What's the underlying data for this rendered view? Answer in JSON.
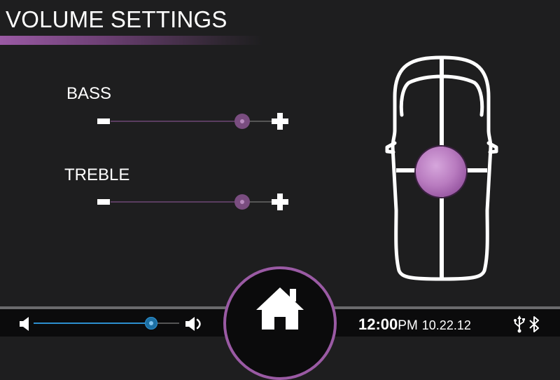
{
  "header": {
    "title": "VOLUME SETTINGS"
  },
  "controls": [
    {
      "id": "bass",
      "label": "BASS",
      "level": 0.82
    },
    {
      "id": "treble",
      "label": "TREBLE",
      "level": 0.82
    }
  ],
  "fader": {
    "icon": "car-top-view-icon",
    "balance": "center",
    "fade": "center"
  },
  "bottom_bar": {
    "volume_level": 0.82,
    "time": "12:00",
    "ampm": "PM",
    "date": "10.22.12",
    "status_icons": [
      "usb-icon",
      "bluetooth-icon"
    ]
  },
  "colors": {
    "accent": "#9a5aa4",
    "fader_knob": "#b97cc0",
    "volume_accent": "#2d8fcf",
    "background": "#1e1e1f",
    "bottom_bar": "#0b0b0c"
  }
}
